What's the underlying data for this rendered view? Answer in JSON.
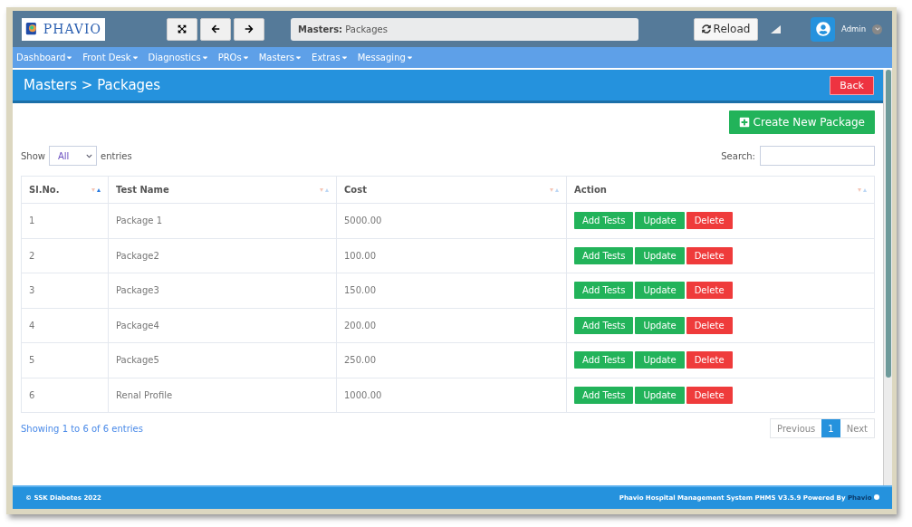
{
  "header": {
    "logo_text": "PHAVIO",
    "breadcrumb": "**Masters:** Packages",
    "reload": "Reload",
    "user": "Admin"
  },
  "nav": [
    {
      "label": "Dashboard"
    },
    {
      "label": "Front Desk"
    },
    {
      "label": "Diagnostics"
    },
    {
      "label": "PROs"
    },
    {
      "label": "Masters"
    },
    {
      "label": "Extras"
    },
    {
      "label": "Messaging"
    }
  ],
  "page_title": "Masters > Packages",
  "back_button": "Back",
  "create_button": "Create New Package",
  "show_entries": {
    "label": "Show",
    "value": "All",
    "suffix": "entries"
  },
  "search": {
    "label": "Search:"
  },
  "table": {
    "columns": [
      {
        "label": "Sl.No.",
        "sorted": true
      },
      {
        "label": "Test Name",
        "sorted": false
      },
      {
        "label": "Cost",
        "sorted": false
      },
      {
        "label": "Action",
        "sorted": false
      }
    ],
    "rows": [
      {
        "no": "1",
        "name": "Package 1",
        "cost": "5000.00",
        "actions": [
          "Add Tests",
          "Update",
          "Delete"
        ]
      },
      {
        "no": "2",
        "name": "Package2",
        "cost": "100.00",
        "actions": [
          "Add Tests",
          "Update",
          "Delete"
        ]
      },
      {
        "no": "3",
        "name": "Package3",
        "cost": "150.00",
        "actions": [
          "Add Tests",
          "Update",
          "Delete"
        ]
      },
      {
        "no": "4",
        "name": "Package4",
        "cost": "200.00",
        "actions": [
          "Add Tests",
          "Update",
          "Delete"
        ]
      },
      {
        "no": "5",
        "name": "Package5",
        "cost": "250.00",
        "actions": [
          "Add Tests",
          "Update",
          "Delete"
        ]
      },
      {
        "no": "6",
        "name": "Renal Profile",
        "cost": "1000.00",
        "actions": [
          "Add Tests",
          "Update",
          "Delete"
        ]
      }
    ]
  },
  "info": "Showing 1 to 6 of 6 entries",
  "pagination": [
    {
      "label": "Previous",
      "selected": false
    },
    {
      "label": "1",
      "selected": true
    },
    {
      "label": "Next",
      "selected": false
    }
  ],
  "footer": {
    "left": "© SSK Diabetes 2022",
    "right": "Phavio Hospital Management System PHMS V3.5.9 Powered By",
    "link": "Phavio"
  }
}
